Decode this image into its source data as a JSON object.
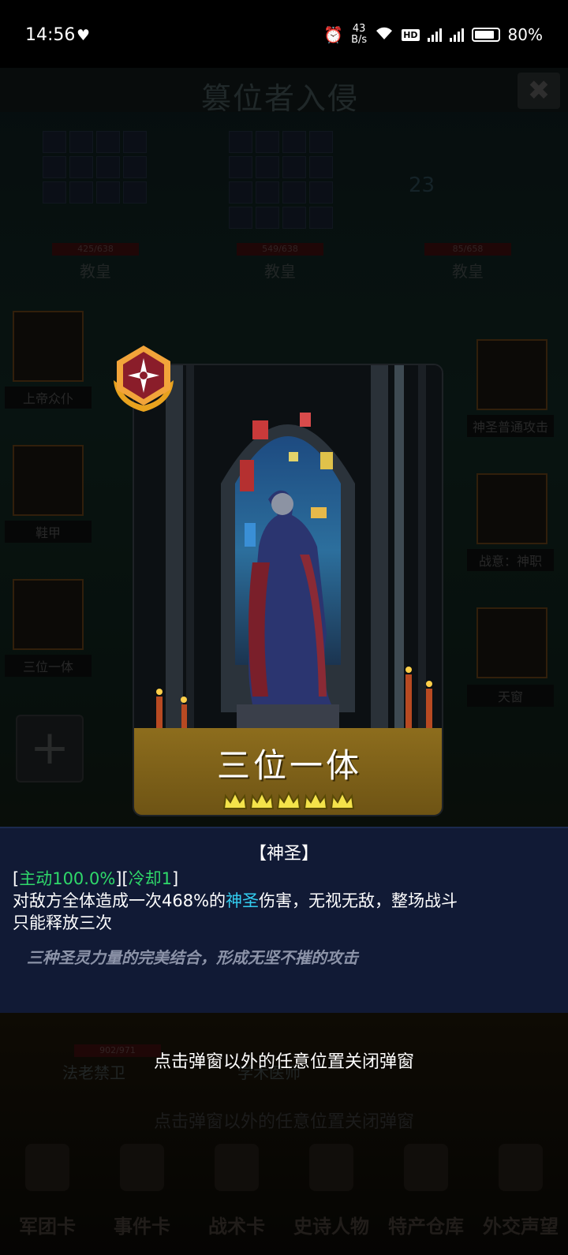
{
  "status_bar": {
    "time": "14:56",
    "net_speed_value": "43",
    "net_speed_unit": "B/s",
    "hd": "HD",
    "battery": "80%"
  },
  "background": {
    "title": "篡位者入侵",
    "enemies": [
      {
        "hp": "425/638",
        "name": "教皇"
      },
      {
        "hp": "549/638",
        "name": "教皇"
      },
      {
        "hp": "85/658",
        "name": "教皇"
      }
    ],
    "counter": "23",
    "left_cards": [
      "上帝众仆",
      "鞋甲",
      "三位一体"
    ],
    "right_cards": [
      "神圣普通攻击",
      "战意：神职",
      "天窗"
    ],
    "bottom_units": [
      {
        "hp": "902/971",
        "name": "法老禁卫"
      },
      {
        "name": "学术医师"
      }
    ],
    "bottom_hint": "点击弹窗以外的任意位置关闭弹窗",
    "nav": [
      "军团卡",
      "事件卡",
      "战术卡",
      "史诗人物",
      "特产仓库",
      "外交声望"
    ]
  },
  "card": {
    "name": "三位一体",
    "stars": 5
  },
  "description": {
    "type": "【神圣】",
    "tag_active": "主动100.0%",
    "tag_cooldown": "冷却1",
    "line1_a": "对敌方全体造成一次468%的",
    "line1_keyword": "神圣",
    "line1_b": "伤害，无视无敌，整场战斗",
    "line2": "只能释放三次",
    "flavor": "三种圣灵力量的完美结合，形成无坚不摧的攻击"
  },
  "close_hint": "点击弹窗以外的任意位置关闭弹窗",
  "colors": {
    "active_tag": "#2fd86a",
    "keyword": "#33cdf0",
    "name_bar": "#8d6d1d",
    "desc_panel": "#111a35"
  }
}
